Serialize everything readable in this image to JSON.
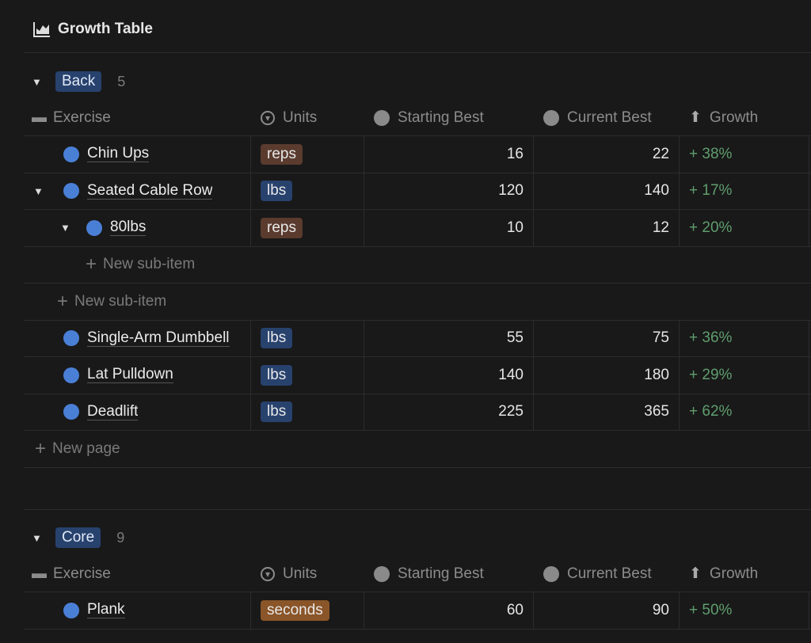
{
  "title": "Growth Table",
  "columns": {
    "exercise": "Exercise",
    "units": "Units",
    "starting": "Starting Best",
    "current": "Current Best",
    "growth": "Growth"
  },
  "new_sub_item": "New sub-item",
  "new_page": "New page",
  "colors": {
    "lbs": "#28426e",
    "reps": "#5a3b2e",
    "seconds": "#8a5528",
    "growth": "#5f9e6e",
    "dot": "#4a7fd6"
  },
  "groups": [
    {
      "name": "Back",
      "count": "5",
      "rows": [
        {
          "type": "item",
          "level": 0,
          "name": "Chin Ups",
          "unit": "reps",
          "start": "16",
          "current": "22",
          "growth": "+ 38%"
        },
        {
          "type": "item",
          "level": 0,
          "expanded": true,
          "name": "Seated Cable Row",
          "unit": "lbs",
          "start": "120",
          "current": "140",
          "growth": "+ 17%"
        },
        {
          "type": "item",
          "level": 1,
          "expanded": true,
          "name": "80lbs",
          "unit": "reps",
          "start": "10",
          "current": "12",
          "growth": "+ 20%"
        },
        {
          "type": "new-sub",
          "level": 2
        },
        {
          "type": "new-sub",
          "level": 1
        },
        {
          "type": "item",
          "level": 0,
          "name": "Single-Arm Dumbbell",
          "unit": "lbs",
          "start": "55",
          "current": "75",
          "growth": "+ 36%"
        },
        {
          "type": "item",
          "level": 0,
          "name": "Lat Pulldown",
          "unit": "lbs",
          "start": "140",
          "current": "180",
          "growth": "+ 29%"
        },
        {
          "type": "item",
          "level": 0,
          "name": "Deadlift",
          "unit": "lbs",
          "start": "225",
          "current": "365",
          "growth": "+ 62%"
        },
        {
          "type": "new-page"
        }
      ]
    },
    {
      "name": "Core",
      "count": "9",
      "rows": [
        {
          "type": "item",
          "level": 0,
          "name": "Plank",
          "unit": "seconds",
          "start": "60",
          "current": "90",
          "growth": "+ 50%"
        }
      ]
    }
  ]
}
